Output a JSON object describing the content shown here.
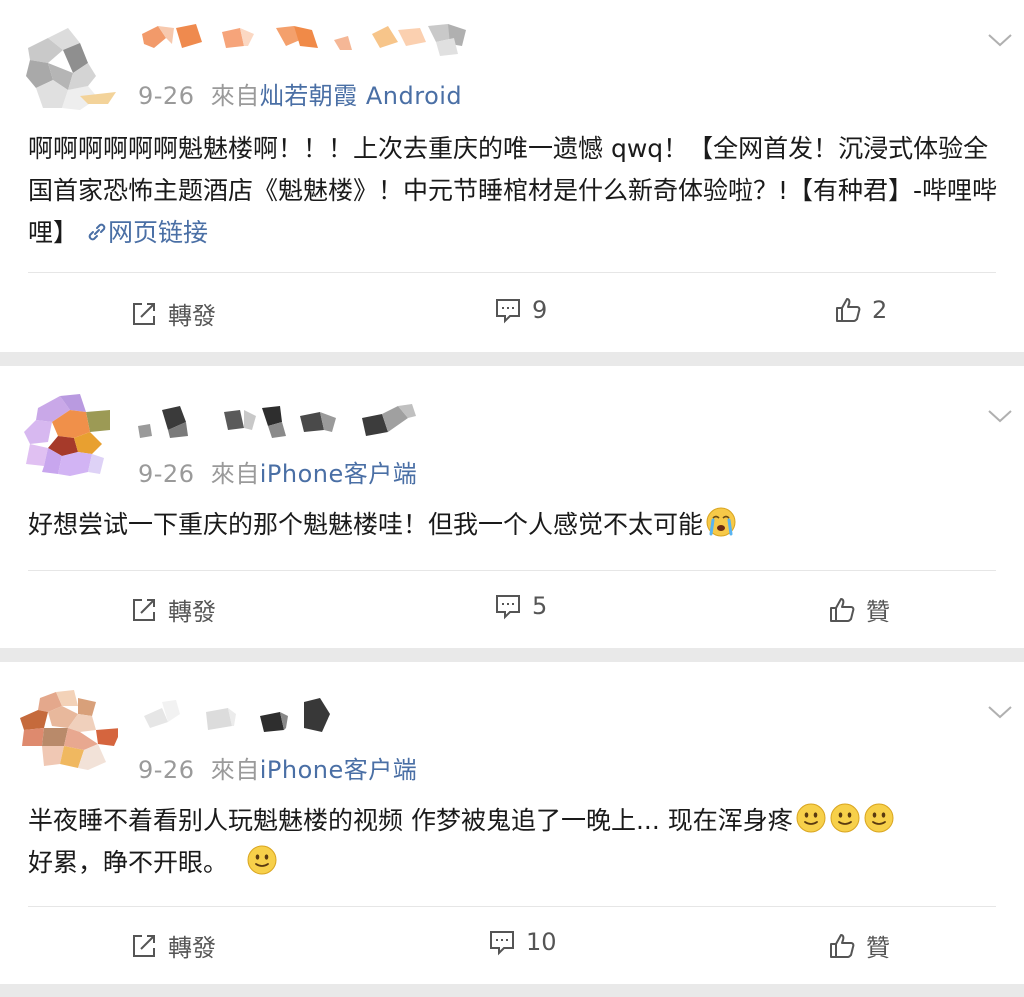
{
  "posts": [
    {
      "date": "9-26",
      "source_prefix": "來自",
      "source": "灿若朝霞 Android",
      "text": "啊啊啊啊啊啊魁魅楼啊！！！上次去重庆的唯一遗憾 qwq！【全网首发！沉浸式体验全国首家恐怖主题酒店《魁魅楼》！中元节睡棺材是什么新奇体验啦？!【有种君】-哔哩哔哩】",
      "link_label": "网页链接",
      "repost_label": "轉發",
      "comment_count": "9",
      "like_label": "2"
    },
    {
      "date": "9-26",
      "source_prefix": "來自",
      "source": "iPhone客户端",
      "text": "好想尝试一下重庆的那个魁魅楼哇！但我一个人感觉不太可能",
      "emoji": "crying-face-emoji",
      "repost_label": "轉發",
      "comment_count": "5",
      "like_label": "贊"
    },
    {
      "date": "9-26",
      "source_prefix": "來自",
      "source": "iPhone客户端",
      "text_line1": "半夜睡不着看别人玩魁魅楼的视频 作梦被鬼追了一晚上... 现在浑身疼",
      "text_line2": "好累，睁不开眼。",
      "emoji": "slight-smile-emoji",
      "repost_label": "轉發",
      "comment_count": "10",
      "like_label": "贊"
    }
  ],
  "colors": {
    "background": "#e9e9e9",
    "card": "#ffffff",
    "meta_gray": "#9a9a9a",
    "link_blue": "#4a6fa5",
    "action_gray": "#555555"
  }
}
